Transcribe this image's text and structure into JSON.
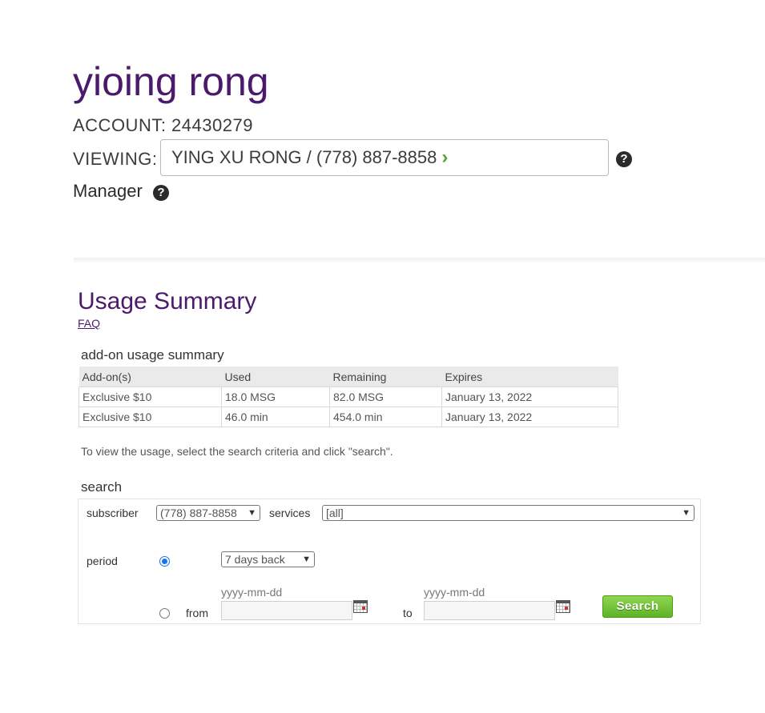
{
  "header": {
    "user_name": "yioing rong",
    "account_label": "ACCOUNT: 24430279",
    "viewing_label": "VIEWING:",
    "viewing_value": "YING XU RONG / (778) 887-8858",
    "role": "Manager",
    "help_glyph": "?"
  },
  "usage": {
    "title": "Usage Summary",
    "faq": "FAQ",
    "addon_title": "add-on usage summary",
    "columns": [
      "Add-on(s)",
      "Used",
      "Remaining",
      "Expires"
    ],
    "rows": [
      [
        "Exclusive $10",
        "18.0 MSG",
        "82.0 MSG",
        "January 13, 2022"
      ],
      [
        "Exclusive $10",
        "46.0 min",
        "454.0 min",
        "January 13, 2022"
      ]
    ],
    "instructions": "To view the usage, select the search criteria and click \"search\"."
  },
  "search": {
    "title": "search",
    "subscriber_label": "subscriber",
    "subscriber_value": "(778) 887-8858",
    "services_label": "services",
    "services_value": "[all]",
    "period_label": "period",
    "period_value": "7 days back",
    "from_label": "from",
    "to_label": "to",
    "date_placeholder_from": "yyyy-mm-dd",
    "date_placeholder_to": "yyyy-mm-dd",
    "button_label": "Search",
    "selected_period_option": "preset"
  },
  "colors": {
    "brand_purple": "#4b1a6b",
    "accent_green": "#5db329",
    "radio_blue": "#1a73e8"
  },
  "icons": [
    "help-icon",
    "chevron-right-icon",
    "chevron-down-icon",
    "calendar-icon"
  ]
}
